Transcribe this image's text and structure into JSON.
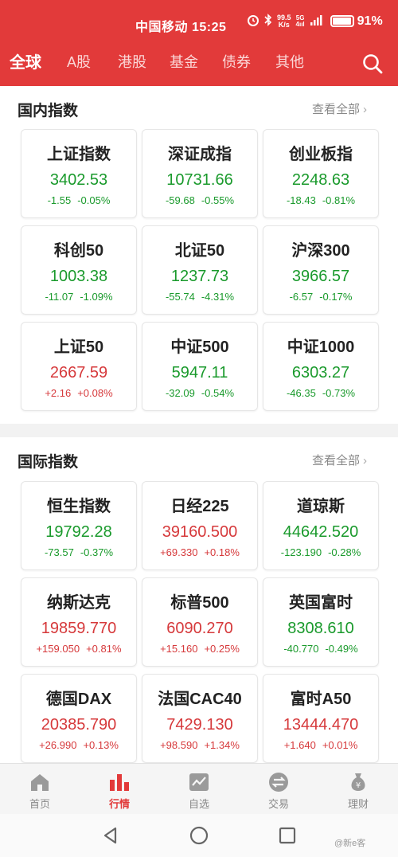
{
  "status_bar": {
    "carrier_time": "中国移动 15:25",
    "net_speed_value": "99.5",
    "net_speed_unit": "K/s",
    "net_type": "5G",
    "net_bars": "4ııl",
    "battery": "91%",
    "battery_level": 0.91
  },
  "top_nav": {
    "tabs": [
      "全球",
      "A股",
      "港股",
      "基金",
      "债券",
      "其他"
    ],
    "active_index": 0
  },
  "domestic": {
    "title": "国内指数",
    "more": "查看全部",
    "cards": [
      {
        "name": "上证指数",
        "price": "3402.53",
        "change": "-1.55",
        "pct": "-0.05%",
        "dir": "down"
      },
      {
        "name": "深证成指",
        "price": "10731.66",
        "change": "-59.68",
        "pct": "-0.55%",
        "dir": "down"
      },
      {
        "name": "创业板指",
        "price": "2248.63",
        "change": "-18.43",
        "pct": "-0.81%",
        "dir": "down"
      },
      {
        "name": "科创50",
        "price": "1003.38",
        "change": "-11.07",
        "pct": "-1.09%",
        "dir": "down"
      },
      {
        "name": "北证50",
        "price": "1237.73",
        "change": "-55.74",
        "pct": "-4.31%",
        "dir": "down"
      },
      {
        "name": "沪深300",
        "price": "3966.57",
        "change": "-6.57",
        "pct": "-0.17%",
        "dir": "down"
      },
      {
        "name": "上证50",
        "price": "2667.59",
        "change": "+2.16",
        "pct": "+0.08%",
        "dir": "up"
      },
      {
        "name": "中证500",
        "price": "5947.11",
        "change": "-32.09",
        "pct": "-0.54%",
        "dir": "down"
      },
      {
        "name": "中证1000",
        "price": "6303.27",
        "change": "-46.35",
        "pct": "-0.73%",
        "dir": "down"
      }
    ]
  },
  "international": {
    "title": "国际指数",
    "more": "查看全部",
    "cards": [
      {
        "name": "恒生指数",
        "price": "19792.28",
        "change": "-73.57",
        "pct": "-0.37%",
        "dir": "down"
      },
      {
        "name": "日经225",
        "price": "39160.500",
        "change": "+69.330",
        "pct": "+0.18%",
        "dir": "up"
      },
      {
        "name": "道琼斯",
        "price": "44642.520",
        "change": "-123.190",
        "pct": "-0.28%",
        "dir": "down"
      },
      {
        "name": "纳斯达克",
        "price": "19859.770",
        "change": "+159.050",
        "pct": "+0.81%",
        "dir": "up"
      },
      {
        "name": "标普500",
        "price": "6090.270",
        "change": "+15.160",
        "pct": "+0.25%",
        "dir": "up"
      },
      {
        "name": "英国富时",
        "price": "8308.610",
        "change": "-40.770",
        "pct": "-0.49%",
        "dir": "down"
      },
      {
        "name": "德国DAX",
        "price": "20385.790",
        "change": "+26.990",
        "pct": "+0.13%",
        "dir": "up"
      },
      {
        "name": "法国CAC40",
        "price": "7429.130",
        "change": "+98.590",
        "pct": "+1.34%",
        "dir": "up"
      },
      {
        "name": "富时A50",
        "price": "13444.470",
        "change": "+1.640",
        "pct": "+0.01%",
        "dir": "up"
      }
    ]
  },
  "bottom_nav": {
    "items": [
      {
        "label": "首页",
        "icon": "home-icon"
      },
      {
        "label": "行情",
        "icon": "market-bars-icon"
      },
      {
        "label": "自选",
        "icon": "watchlist-chart-icon"
      },
      {
        "label": "交易",
        "icon": "trade-exchange-icon"
      },
      {
        "label": "理财",
        "icon": "money-bag-icon"
      }
    ],
    "active_index": 1
  },
  "watermark": "@新e客",
  "colors": {
    "brand_red": "#e23a3a",
    "down_green": "#1a9a2c",
    "up_red": "#d6393b"
  }
}
